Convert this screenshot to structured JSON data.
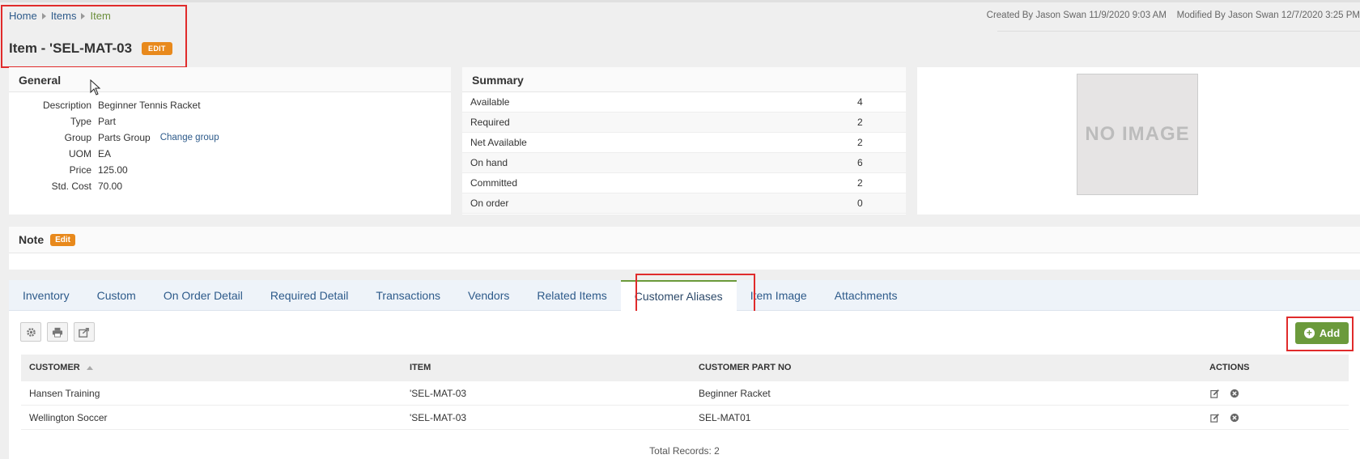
{
  "breadcrumb": {
    "home": "Home",
    "items": "Items",
    "current": "Item"
  },
  "title": {
    "text": "Item - 'SEL-MAT-03",
    "edit": "EDIT"
  },
  "audit": "Created By Jason Swan 11/9/2020 9:03 AM    Modified By Jason Swan 12/7/2020 3:25 PM",
  "general": {
    "heading": "General",
    "rows": [
      {
        "k": "Description",
        "v": "Beginner Tennis Racket"
      },
      {
        "k": "Type",
        "v": "Part"
      },
      {
        "k": "Group",
        "v": "Parts Group"
      },
      {
        "k": "UOM",
        "v": "EA"
      },
      {
        "k": "Price",
        "v": "125.00"
      },
      {
        "k": "Std. Cost",
        "v": "70.00"
      }
    ],
    "change_group": "Change group"
  },
  "summary": {
    "heading": "Summary",
    "rows": [
      {
        "l": "Available",
        "v": "4"
      },
      {
        "l": "Required",
        "v": "2"
      },
      {
        "l": "Net Available",
        "v": "2"
      },
      {
        "l": "On hand",
        "v": "6"
      },
      {
        "l": "Committed",
        "v": "2"
      },
      {
        "l": "On order",
        "v": "0"
      }
    ]
  },
  "image": {
    "placeholder": "NO IMAGE"
  },
  "note": {
    "heading": "Note",
    "edit": "Edit"
  },
  "tabs": [
    "Inventory",
    "Custom",
    "On Order Detail",
    "Required Detail",
    "Transactions",
    "Vendors",
    "Related Items",
    "Customer Aliases",
    "Item Image",
    "Attachments"
  ],
  "active_tab": "Customer Aliases",
  "toolbar": {
    "add": "Add",
    "icons": [
      "gear-icon",
      "print-icon",
      "export-icon"
    ]
  },
  "grid": {
    "headers": [
      "CUSTOMER",
      "ITEM",
      "CUSTOMER PART NO",
      "ACTIONS"
    ],
    "rows": [
      {
        "customer": "Hansen Training",
        "item": "'SEL-MAT-03",
        "part": "Beginner Racket"
      },
      {
        "customer": "Wellington Soccer",
        "item": "'SEL-MAT-03",
        "part": "SEL-MAT01"
      }
    ],
    "total": "Total Records: 2"
  },
  "colors": {
    "accent_green": "#6b9a3b",
    "badge_orange": "#e8891c",
    "link_blue": "#2d5a8a",
    "highlight_red": "#e02b2b"
  }
}
